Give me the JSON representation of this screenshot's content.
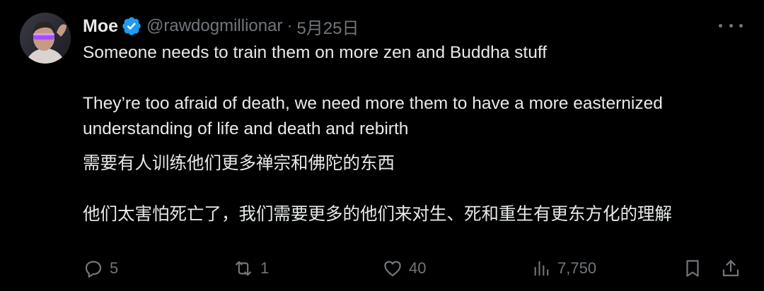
{
  "author": {
    "display_name": "Moe",
    "handle": "@rawdogmillionar",
    "separator": "·",
    "timestamp": "5月25日",
    "verified_icon": "verified-badge-icon",
    "verified_color": "#1d9bf0"
  },
  "tweet": {
    "lines": [
      "Someone needs to train them on more zen and Buddha stuff",
      "They’re too afraid of death, we need more them to have a more easternized",
      "understanding of life and death and rebirth",
      "需要有人训练他们更多禅宗和佛陀的东西",
      "他们太害怕死亡了，我们需要更多的他们来对生、死和重生有更东方化的理解"
    ]
  },
  "actions": {
    "reply": {
      "icon": "reply-icon",
      "count": "5"
    },
    "retweet": {
      "icon": "retweet-icon",
      "count": "1"
    },
    "like": {
      "icon": "heart-icon",
      "count": "40"
    },
    "views": {
      "icon": "views-icon",
      "count": "7,750"
    },
    "bookmark": {
      "icon": "bookmark-icon"
    },
    "share": {
      "icon": "share-icon"
    }
  },
  "colors": {
    "background": "#000000",
    "primary_text": "#e7e9ea",
    "secondary_text": "#71767b",
    "accent": "#1d9bf0"
  }
}
